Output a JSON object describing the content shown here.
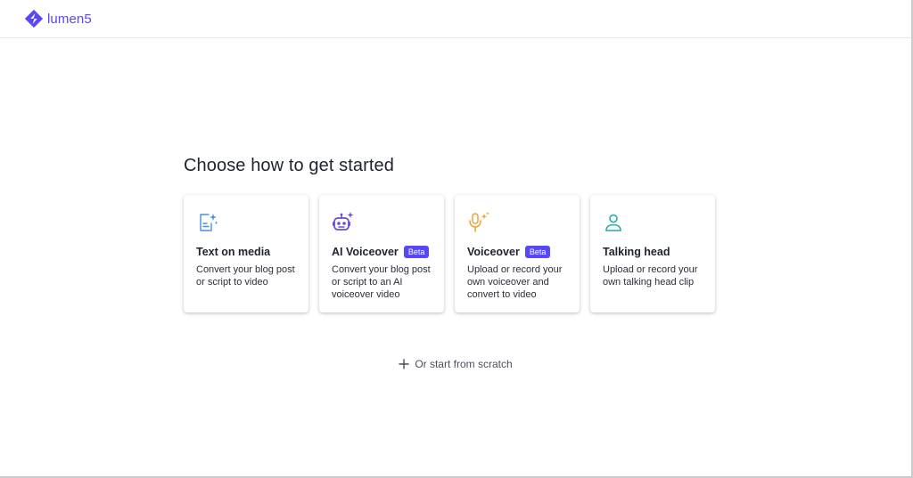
{
  "brand": {
    "name": "lumen5",
    "color": "#5846f9"
  },
  "main": {
    "title": "Choose how to get started",
    "options": [
      {
        "title": "Text on media",
        "badge": "",
        "description": "Convert your blog post or script to video",
        "icon": "document-sparkle-icon",
        "icon_color": "#4a90d9"
      },
      {
        "title": "AI Voiceover",
        "badge": "Beta",
        "description": "Convert your blog post or script to an AI voiceover video",
        "icon": "robot-sparkle-icon",
        "icon_color": "#6a4bd8"
      },
      {
        "title": "Voiceover",
        "badge": "Beta",
        "description": "Upload or record your own voiceover and convert to video",
        "icon": "microphone-sparkle-icon",
        "icon_color": "#f0a030"
      },
      {
        "title": "Talking head",
        "badge": "",
        "description": "Upload or record your own talking head clip",
        "icon": "person-icon",
        "icon_color": "#2aa7a7"
      }
    ],
    "scratch_label": "Or start from scratch"
  }
}
